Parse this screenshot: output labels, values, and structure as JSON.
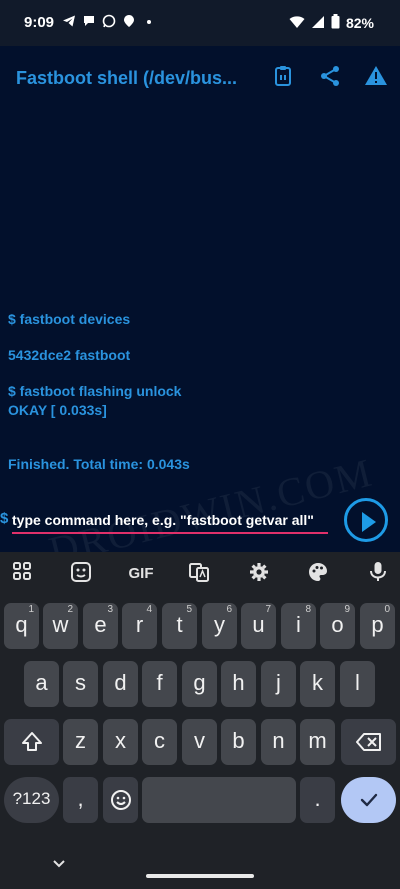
{
  "status_bar": {
    "time": "9:09",
    "battery": "82%",
    "notification_icons": [
      "telegram-icon",
      "chat-icon",
      "whatsapp-icon",
      "notification-app-icon",
      "dot-icon"
    ]
  },
  "app_bar": {
    "title": "Fastboot shell (/dev/bus...",
    "actions": [
      "paste-icon",
      "share-icon",
      "warning-icon"
    ]
  },
  "console": {
    "lines": [
      "$ fastboot devices",
      "5432dce2 fastboot",
      "$ fastboot flashing unlock",
      "OKAY [  0.033s]",
      "Finished. Total time: 0.043s"
    ],
    "watermark": "DROIDWIN.COM"
  },
  "command": {
    "prompt": "$",
    "placeholder": "type command here, e.g. \"fastboot getvar all\"",
    "value": ""
  },
  "keyboard": {
    "toolbar": {
      "gif_label": "GIF"
    },
    "row1": [
      {
        "k": "q",
        "h": "1"
      },
      {
        "k": "w",
        "h": "2"
      },
      {
        "k": "e",
        "h": "3"
      },
      {
        "k": "r",
        "h": "4"
      },
      {
        "k": "t",
        "h": "5"
      },
      {
        "k": "y",
        "h": "6"
      },
      {
        "k": "u",
        "h": "7"
      },
      {
        "k": "i",
        "h": "8"
      },
      {
        "k": "o",
        "h": "9"
      },
      {
        "k": "p",
        "h": "0"
      }
    ],
    "row2": [
      "a",
      "s",
      "d",
      "f",
      "g",
      "h",
      "j",
      "k",
      "l"
    ],
    "row3": [
      "z",
      "x",
      "c",
      "v",
      "b",
      "n",
      "m"
    ],
    "symbols_label": "?123",
    "comma_label": ",",
    "period_label": "."
  },
  "colors": {
    "console_text": "#2a93de",
    "background": "#02102c",
    "input_underline": "#e0306a",
    "keyboard_bg": "#1f2227",
    "key_bg": "#44474d"
  }
}
